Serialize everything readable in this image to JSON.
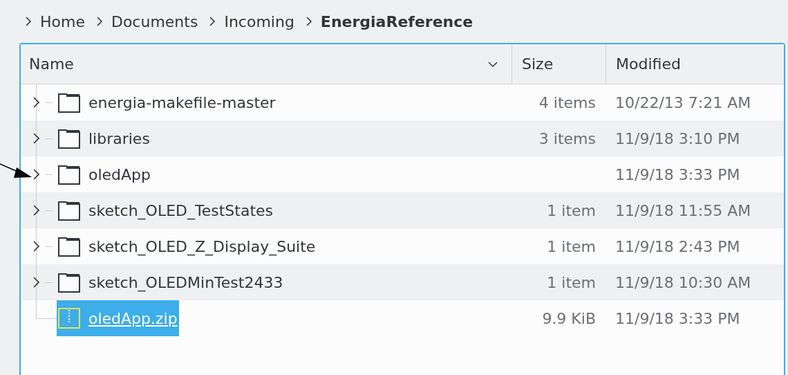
{
  "breadcrumb": [
    {
      "label": "Home",
      "current": false
    },
    {
      "label": "Documents",
      "current": false
    },
    {
      "label": "Incoming",
      "current": false
    },
    {
      "label": "EnergiaReference",
      "current": true
    }
  ],
  "table": {
    "columns": [
      {
        "label": "Name",
        "sorted": true
      },
      {
        "label": "Size",
        "sorted": false
      },
      {
        "label": "Modified",
        "sorted": false
      }
    ],
    "rows": [
      {
        "kind": "folder",
        "name": "energia-makefile-master",
        "size": "4 items",
        "modified": "10/22/13 7:21 AM",
        "selected": false
      },
      {
        "kind": "folder",
        "name": "libraries",
        "size": "3 items",
        "modified": "11/9/18 3:10 PM",
        "selected": false
      },
      {
        "kind": "folder",
        "name": "oledApp",
        "modified": "11/9/18 3:33 PM",
        "selected": false
      },
      {
        "kind": "folder",
        "name": "sketch_OLED_TestStates",
        "size": "1 item",
        "modified": "11/9/18 11:55 AM",
        "selected": false
      },
      {
        "kind": "folder",
        "name": "sketch_OLED_Z_Display_Suite",
        "size": "1 item",
        "modified": "11/9/18 2:43 PM",
        "selected": false
      },
      {
        "kind": "folder",
        "name": "sketch_OLEDMinTest2433",
        "size": "1 item",
        "modified": "11/9/18 10:30 AM",
        "selected": false
      },
      {
        "kind": "archive",
        "name": "oledApp.zip",
        "size": "9.9 KiB",
        "modified": "11/9/18 3:33 PM",
        "selected": true
      }
    ]
  }
}
